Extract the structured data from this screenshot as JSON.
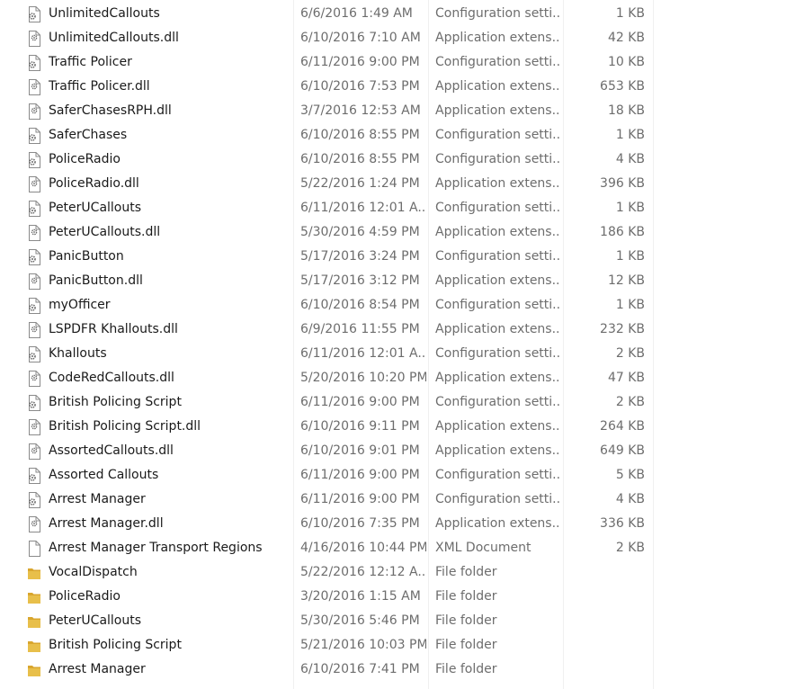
{
  "files": [
    {
      "name": "UnlimitedCallouts",
      "date": "6/6/2016 1:49 AM",
      "type": "Configuration setti...",
      "size": "1 KB",
      "icon": "config-icon"
    },
    {
      "name": "UnlimitedCallouts.dll",
      "date": "6/10/2016 7:10 AM",
      "type": "Application extens...",
      "size": "42 KB",
      "icon": "dll-icon"
    },
    {
      "name": "Traffic Policer",
      "date": "6/11/2016 9:00 PM",
      "type": "Configuration setti...",
      "size": "10 KB",
      "icon": "config-icon"
    },
    {
      "name": "Traffic Policer.dll",
      "date": "6/10/2016 7:53 PM",
      "type": "Application extens...",
      "size": "653 KB",
      "icon": "dll-icon"
    },
    {
      "name": "SaferChasesRPH.dll",
      "date": "3/7/2016 12:53 AM",
      "type": "Application extens...",
      "size": "18 KB",
      "icon": "dll-icon"
    },
    {
      "name": "SaferChases",
      "date": "6/10/2016 8:55 PM",
      "type": "Configuration setti...",
      "size": "1 KB",
      "icon": "config-icon"
    },
    {
      "name": "PoliceRadio",
      "date": "6/10/2016 8:55 PM",
      "type": "Configuration setti...",
      "size": "4 KB",
      "icon": "config-icon"
    },
    {
      "name": "PoliceRadio.dll",
      "date": "5/22/2016 1:24 PM",
      "type": "Application extens...",
      "size": "396 KB",
      "icon": "dll-icon"
    },
    {
      "name": "PeterUCallouts",
      "date": "6/11/2016 12:01 A...",
      "type": "Configuration setti...",
      "size": "1 KB",
      "icon": "config-icon"
    },
    {
      "name": "PeterUCallouts.dll",
      "date": "5/30/2016 4:59 PM",
      "type": "Application extens...",
      "size": "186 KB",
      "icon": "dll-icon"
    },
    {
      "name": "PanicButton",
      "date": "5/17/2016 3:24 PM",
      "type": "Configuration setti...",
      "size": "1 KB",
      "icon": "config-icon"
    },
    {
      "name": "PanicButton.dll",
      "date": "5/17/2016 3:12 PM",
      "type": "Application extens...",
      "size": "12 KB",
      "icon": "dll-icon"
    },
    {
      "name": "myOfficer",
      "date": "6/10/2016 8:54 PM",
      "type": "Configuration setti...",
      "size": "1 KB",
      "icon": "config-icon"
    },
    {
      "name": "LSPDFR Khallouts.dll",
      "date": "6/9/2016 11:55 PM",
      "type": "Application extens...",
      "size": "232 KB",
      "icon": "dll-icon"
    },
    {
      "name": "Khallouts",
      "date": "6/11/2016 12:01 A...",
      "type": "Configuration setti...",
      "size": "2 KB",
      "icon": "config-icon"
    },
    {
      "name": "CodeRedCallouts.dll",
      "date": "5/20/2016 10:20 PM",
      "type": "Application extens...",
      "size": "47 KB",
      "icon": "dll-icon"
    },
    {
      "name": "British Policing Script",
      "date": "6/11/2016 9:00 PM",
      "type": "Configuration setti...",
      "size": "2 KB",
      "icon": "config-icon"
    },
    {
      "name": "British Policing Script.dll",
      "date": "6/10/2016 9:11 PM",
      "type": "Application extens...",
      "size": "264 KB",
      "icon": "dll-icon"
    },
    {
      "name": "AssortedCallouts.dll",
      "date": "6/10/2016 9:01 PM",
      "type": "Application extens...",
      "size": "649 KB",
      "icon": "dll-icon"
    },
    {
      "name": "Assorted Callouts",
      "date": "6/11/2016 9:00 PM",
      "type": "Configuration setti...",
      "size": "5 KB",
      "icon": "config-icon"
    },
    {
      "name": "Arrest Manager",
      "date": "6/11/2016 9:00 PM",
      "type": "Configuration setti...",
      "size": "4 KB",
      "icon": "config-icon"
    },
    {
      "name": "Arrest Manager.dll",
      "date": "6/10/2016 7:35 PM",
      "type": "Application extens...",
      "size": "336 KB",
      "icon": "dll-icon"
    },
    {
      "name": "Arrest Manager Transport Regions",
      "date": "4/16/2016 10:44 PM",
      "type": "XML Document",
      "size": "2 KB",
      "icon": "xml-document-icon"
    },
    {
      "name": "VocalDispatch",
      "date": "5/22/2016 12:12 A...",
      "type": "File folder",
      "size": "",
      "icon": "folder-icon"
    },
    {
      "name": "PoliceRadio",
      "date": "3/20/2016 1:15 AM",
      "type": "File folder",
      "size": "",
      "icon": "folder-icon"
    },
    {
      "name": "PeterUCallouts",
      "date": "5/30/2016 5:46 PM",
      "type": "File folder",
      "size": "",
      "icon": "folder-icon"
    },
    {
      "name": "British Policing Script",
      "date": "5/21/2016 10:03 PM",
      "type": "File folder",
      "size": "",
      "icon": "folder-icon"
    },
    {
      "name": "Arrest Manager",
      "date": "6/10/2016 7:41 PM",
      "type": "File folder",
      "size": "",
      "icon": "folder-icon"
    }
  ],
  "colors": {
    "folder": "#e8bf4a",
    "folder_dark": "#d9a62e",
    "document_stroke": "#8a8a8a",
    "gear": "#6b6b6b"
  }
}
